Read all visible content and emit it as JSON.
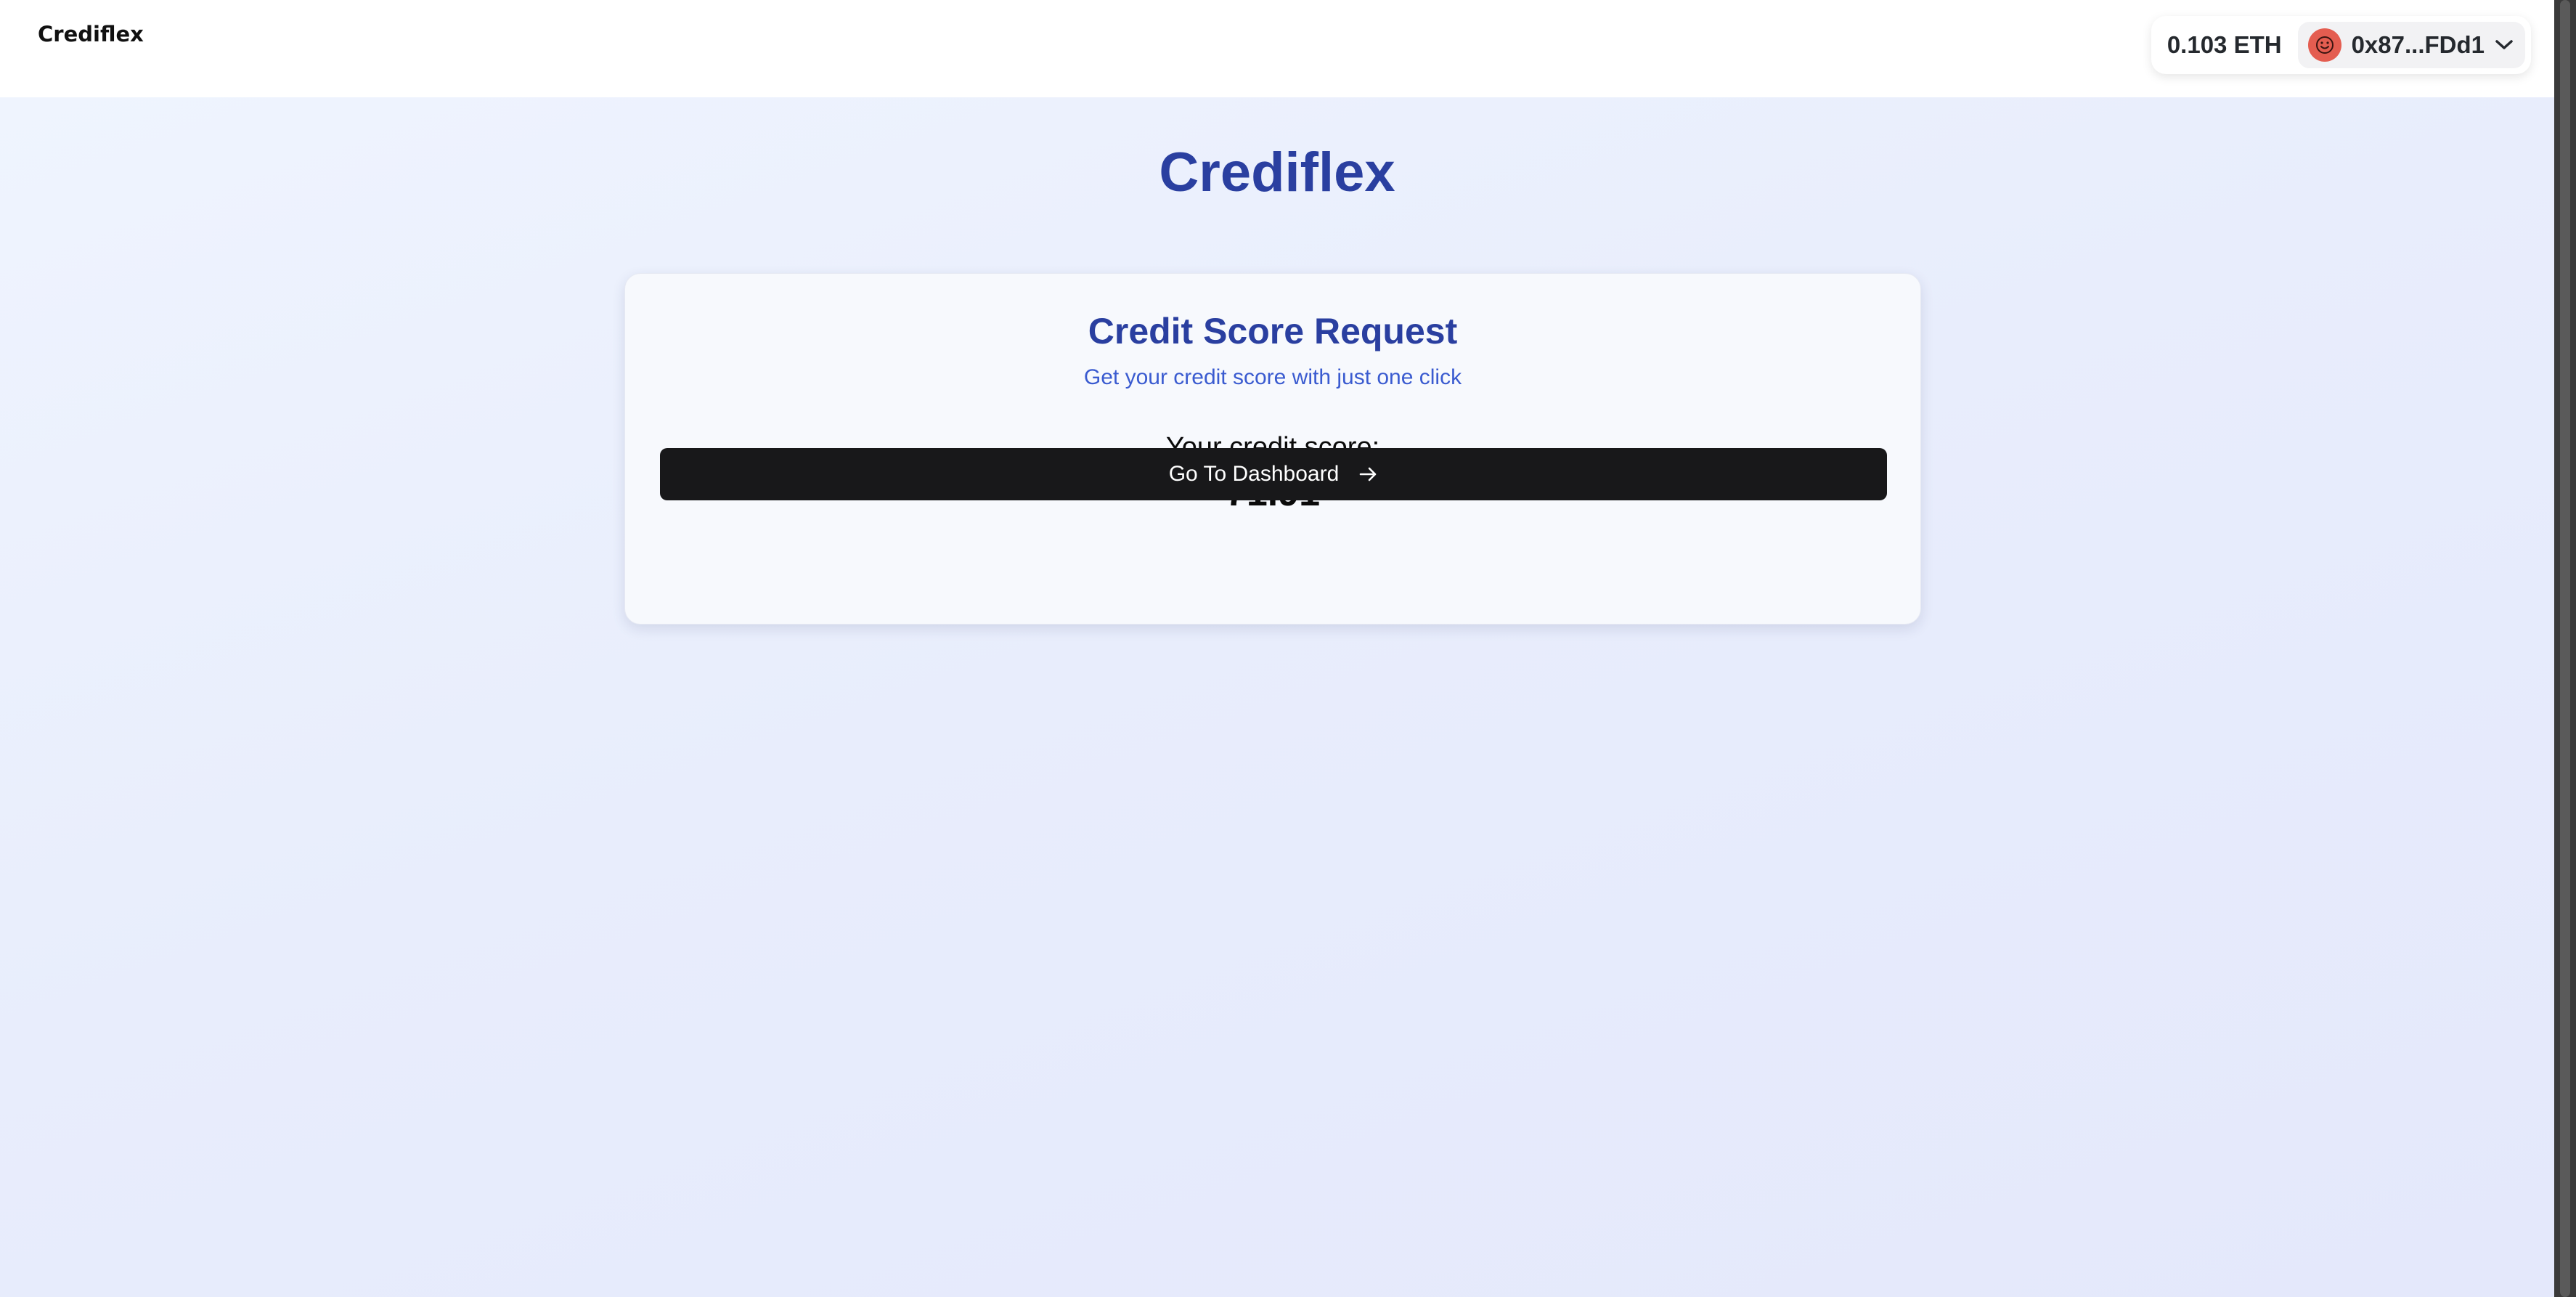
{
  "header": {
    "brand": "Crediflex",
    "wallet": {
      "balance": "0.103 ETH",
      "address": "0x87...FDd1",
      "avatar_color": "#e45d50",
      "avatar_icon": "smiley-face-icon",
      "dropdown_icon": "chevron-down-icon"
    }
  },
  "main": {
    "app_title": "Crediflex",
    "card": {
      "title": "Credit Score Request",
      "subtitle": "Get your credit score with just one click",
      "score_label": "Your credit score:",
      "score_value": "71.91",
      "cta": {
        "label": "Go To Dashboard",
        "icon": "arrow-right-icon"
      }
    }
  },
  "colors": {
    "accent": "#2a3fa0",
    "subtitle": "#3a5bd0",
    "button": "#18181a"
  }
}
